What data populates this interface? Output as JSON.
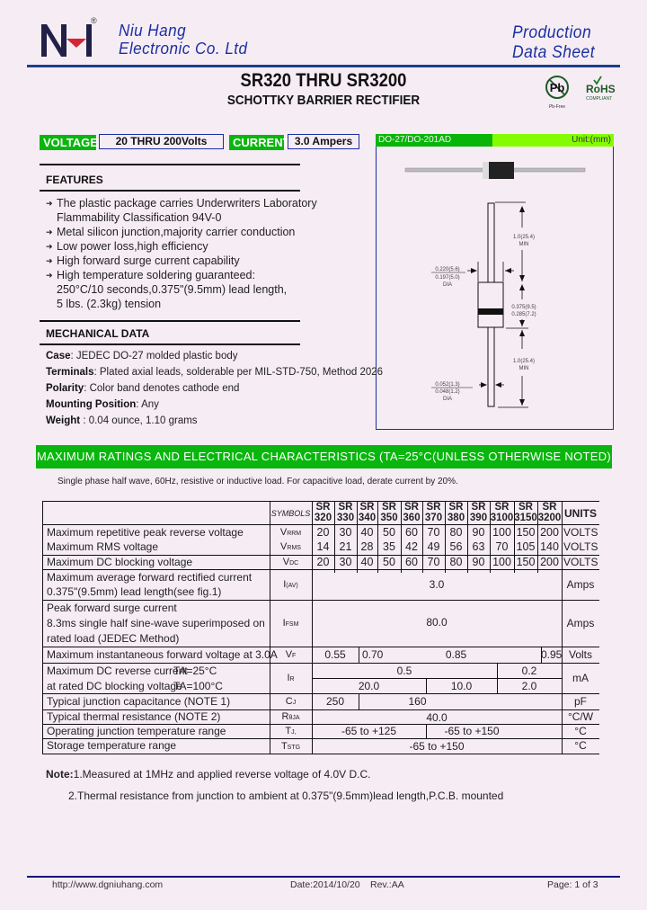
{
  "header": {
    "company_line1": "Niu Hang",
    "company_line2": "Electronic Co. Ltd",
    "registered_mark": "®",
    "doc_type_line1": "Production",
    "doc_type_line2": "Data Sheet",
    "title": "SR320 THRU SR3200",
    "subtitle": "SCHOTTKY BARRIER RECTIFIER",
    "badges": {
      "pb_free": "Pb-Free",
      "pb_symbol": "Pb",
      "rohs": "RoHS",
      "rohs_sub": "COMPLIANT"
    }
  },
  "spec_bar": {
    "voltage_label": "VOLTAGE",
    "voltage_value": "20 THRU 200Volts",
    "current_label": "CURRENT",
    "current_value": "3.0 Ampers"
  },
  "package": {
    "name": "DO-27/DO-201AD",
    "unit": "Unit:(mm)",
    "dims": {
      "lead_length_top": [
        "1.0(25.4)",
        "MIN"
      ],
      "body_dia": [
        "0.220(5.6)",
        "0.197(5.0)",
        "DIA"
      ],
      "body_length": [
        "0.375(9.5)",
        "0.285(7.2)"
      ],
      "lead_length_bottom": [
        "1.0(25.4)",
        "MIN"
      ],
      "lead_dia": [
        "0.052(1.3)",
        "0.048(1.2)",
        "DIA"
      ]
    }
  },
  "features": {
    "title": "FEATURES",
    "items": [
      [
        "The plastic package carries Underwriters Laboratory",
        "Flammability Classification 94V-0"
      ],
      [
        "Metal silicon junction,majority carrier conduction"
      ],
      [
        "Low power loss,high efficiency"
      ],
      [
        "High forward surge current capability"
      ],
      [
        "High temperature soldering guaranteed:",
        "250°C/10 seconds,0.375\"(9.5mm) lead length,",
        "5 lbs. (2.3kg) tension"
      ]
    ]
  },
  "mechanical": {
    "title": "MECHANICAL DATA",
    "rows": [
      {
        "label": "Case",
        "sep": ": ",
        "value": "JEDEC DO-27 molded plastic body"
      },
      {
        "label": "Terminals",
        "sep": ": ",
        "value": "Plated axial leads, solderable per MIL-STD-750, Method 2026"
      },
      {
        "label": "Polarity",
        "sep": ": ",
        "value": "Color band denotes cathode end"
      },
      {
        "label": "Mounting Position",
        "sep": ": ",
        "value": "Any"
      },
      {
        "label": "Weight",
        "sep": " : ",
        "value": "0.04 ounce, 1.10 grams"
      }
    ]
  },
  "ratings": {
    "banner": "MAXIMUM RATINGS AND ELECTRICAL CHARACTERISTICS (TA=25°C(UNLESS OTHERWISE NOTED)",
    "condition": "Single phase half wave, 60Hz, resistive or inductive load. For capacitive load, derate current by 20%.",
    "header": {
      "symbols": "SYMBOLS",
      "units": "UNITS",
      "parts": [
        [
          "SR",
          "320"
        ],
        [
          "SR",
          "330"
        ],
        [
          "SR",
          "340"
        ],
        [
          "SR",
          "350"
        ],
        [
          "SR",
          "360"
        ],
        [
          "SR",
          "370"
        ],
        [
          "SR",
          "380"
        ],
        [
          "SR",
          "390"
        ],
        [
          "SR",
          "3100"
        ],
        [
          "SR",
          "3150"
        ],
        [
          "SR",
          "3200"
        ]
      ]
    },
    "rows": {
      "vrrm": {
        "desc": "Maximum repetitive peak reverse voltage",
        "sym": "V",
        "sub": "RRM",
        "values": [
          "20",
          "30",
          "40",
          "50",
          "60",
          "70",
          "80",
          "90",
          "100",
          "150",
          "200"
        ],
        "unit": "VOLTS"
      },
      "vrms": {
        "desc": "Maximum RMS voltage",
        "sym": "V",
        "sub": "RMS",
        "values": [
          "14",
          "21",
          "28",
          "35",
          "42",
          "49",
          "56",
          "63",
          "70",
          "105",
          "140"
        ],
        "unit": "VOLTS"
      },
      "vdc": {
        "desc": "Maximum DC blocking voltage",
        "sym": "V",
        "sub": "DC",
        "values": [
          "20",
          "30",
          "40",
          "50",
          "60",
          "70",
          "80",
          "90",
          "100",
          "150",
          "200"
        ],
        "unit": "VOLTS"
      },
      "iav": {
        "desc1": "Maximum average forward rectified current",
        "desc2": "0.375\"(9.5mm) lead length(see fig.1)",
        "sym": "I",
        "sub": "(AV)",
        "value": "3.0",
        "unit": "Amps"
      },
      "ifsm": {
        "desc1": "Peak forward surge current",
        "desc2": "8.3ms single half sine-wave superimposed on",
        "desc3": "rated load (JEDEC Method)",
        "sym": "I",
        "sub": "FSM",
        "value": "80.0",
        "unit": "Amps"
      },
      "vf": {
        "desc": "Maximum instantaneous forward voltage at 3.0A",
        "sym": "V",
        "sub": "F",
        "values": [
          "0.55",
          "0.70",
          "0.85",
          "0.95"
        ],
        "unit": "Volts"
      },
      "ir": {
        "desc1": "Maximum DC reverse current",
        "cond1": "TA=25°C",
        "desc2": "at rated DC blocking voltage",
        "cond2": "TA=100°C",
        "sym": "I",
        "sub": "R",
        "values_25": [
          "0.5",
          "0.2"
        ],
        "values_100": [
          "20.0",
          "10.0",
          "2.0"
        ],
        "unit": "mA"
      },
      "cj": {
        "desc": "Typical junction capacitance (NOTE 1)",
        "sym": "C",
        "sub": "J",
        "values": [
          "250",
          "160"
        ],
        "unit": "pF"
      },
      "rthja": {
        "desc": "Typical thermal resistance (NOTE 2)",
        "sym": "R",
        "sub": "θJA",
        "value": "40.0",
        "unit": "°C/W"
      },
      "tj": {
        "desc": "Operating junction temperature range",
        "sym": "T",
        "sub": "J,",
        "values": [
          "-65 to +125",
          "-65 to +150"
        ],
        "unit": "°C"
      },
      "tstg": {
        "desc": "Storage temperature range",
        "sym": "T",
        "sub": "STG",
        "value": "-65 to +150",
        "unit": "°C"
      }
    }
  },
  "notes": {
    "label": "Note:",
    "n1": "1.Measured at 1MHz and applied reverse voltage of 4.0V D.C.",
    "n2": "2.Thermal resistance from junction to ambient  at 0.375\"(9.5mm)lead length,P.C.B. mounted"
  },
  "footer": {
    "url": "http://www.dgniuhang.com",
    "date": "Date:2014/10/20",
    "rev": "Rev.:AA",
    "page": "Page: 1 of 3"
  }
}
